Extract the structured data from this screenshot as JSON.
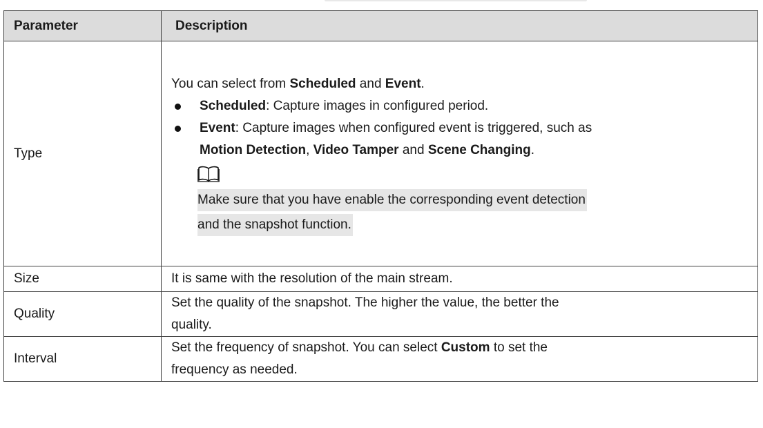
{
  "table": {
    "headers": {
      "parameter": "Parameter",
      "description": "Description"
    },
    "rows": {
      "type": {
        "name": "Type",
        "intro_pre": "You can select from ",
        "intro_b1": "Scheduled",
        "intro_mid": " and ",
        "intro_b2": "Event",
        "intro_end": ".",
        "bullet1_b": "Scheduled",
        "bullet1_text": ": Capture images in configured period.",
        "bullet2_b": "Event",
        "bullet2_text": ": Capture images when configured event is triggered, such as",
        "bullet2_b2": "Motion Detection",
        "bullet2_c1": ", ",
        "bullet2_b3": "Video Tamper",
        "bullet2_c2": " and ",
        "bullet2_b4": "Scene Changing",
        "bullet2_c3": ".",
        "note_icon": "book-note-icon",
        "note_line1": "Make sure that you have enable the corresponding event detection",
        "note_line2": "and the snapshot function."
      },
      "size": {
        "name": "Size",
        "desc": "It is same with the resolution of the main stream."
      },
      "quality": {
        "name": "Quality",
        "desc_line1": "Set the quality of the snapshot. The higher the value, the better the",
        "desc_line2": "quality."
      },
      "interval": {
        "name": "Interval",
        "desc_pre": "Set the frequency of snapshot. You can select ",
        "desc_b": "Custom",
        "desc_post": " to set the",
        "desc_line2": "frequency as needed."
      }
    }
  }
}
